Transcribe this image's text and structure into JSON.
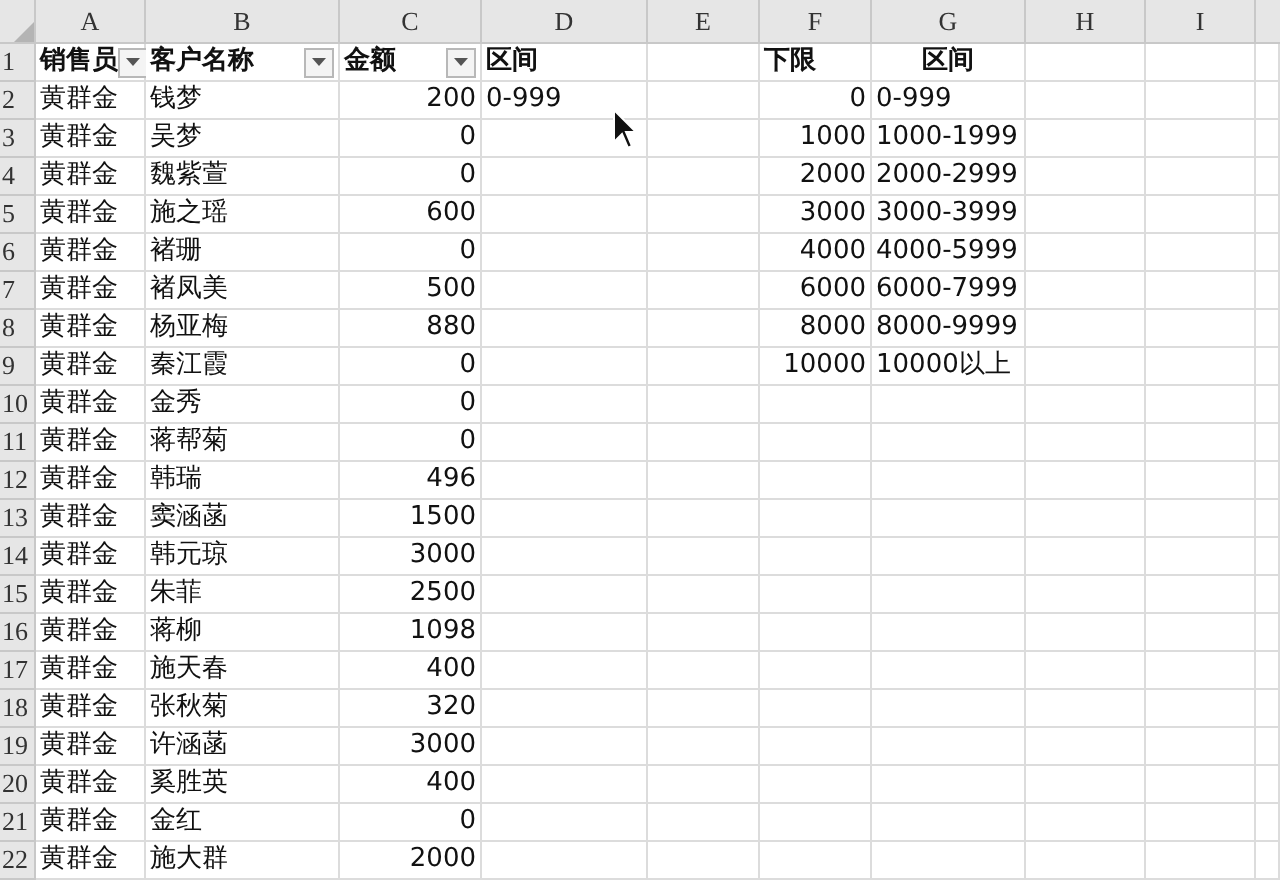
{
  "columns": [
    "A",
    "B",
    "C",
    "D",
    "E",
    "F",
    "G",
    "H",
    "I"
  ],
  "header_row": {
    "number": "1",
    "cells": {
      "a": {
        "text": "销售员",
        "centered": false,
        "filter": true
      },
      "b": {
        "text": "客户名称",
        "centered": false,
        "filter": true
      },
      "c": {
        "text": "金额",
        "centered": false,
        "filter": true
      },
      "d": {
        "text": "区间",
        "centered": false,
        "filter": false
      },
      "f": {
        "text": "下限",
        "centered": false,
        "filter": false
      },
      "g": {
        "text": "区间",
        "centered": true,
        "filter": false
      }
    }
  },
  "rows": [
    {
      "number": "2",
      "a": "黄群金",
      "b": "钱梦",
      "c": "200",
      "d": "0-999",
      "f": "0",
      "g": "0-999"
    },
    {
      "number": "3",
      "a": "黄群金",
      "b": "吴梦",
      "c": "0",
      "f": "1000",
      "g": "1000-1999"
    },
    {
      "number": "4",
      "a": "黄群金",
      "b": "魏紫萱",
      "c": "0",
      "f": "2000",
      "g": "2000-2999"
    },
    {
      "number": "5",
      "a": "黄群金",
      "b": "施之瑶",
      "c": "600",
      "f": "3000",
      "g": "3000-3999"
    },
    {
      "number": "6",
      "a": "黄群金",
      "b": "褚珊",
      "c": "0",
      "f": "4000",
      "g": "4000-5999"
    },
    {
      "number": "7",
      "a": "黄群金",
      "b": "褚凤美",
      "c": "500",
      "f": "6000",
      "g": "6000-7999"
    },
    {
      "number": "8",
      "a": "黄群金",
      "b": "杨亚梅",
      "c": "880",
      "f": "8000",
      "g": "8000-9999"
    },
    {
      "number": "9",
      "a": "黄群金",
      "b": "秦江霞",
      "c": "0",
      "f": "10000",
      "g": "10000以上"
    },
    {
      "number": "10",
      "a": "黄群金",
      "b": "金秀",
      "c": "0"
    },
    {
      "number": "11",
      "a": "黄群金",
      "b": "蒋帮菊",
      "c": "0"
    },
    {
      "number": "12",
      "a": "黄群金",
      "b": "韩瑞",
      "c": "496"
    },
    {
      "number": "13",
      "a": "黄群金",
      "b": "窦涵菡",
      "c": "1500"
    },
    {
      "number": "14",
      "a": "黄群金",
      "b": "韩元琼",
      "c": "3000"
    },
    {
      "number": "15",
      "a": "黄群金",
      "b": "朱菲",
      "c": "2500"
    },
    {
      "number": "16",
      "a": "黄群金",
      "b": "蒋柳",
      "c": "1098"
    },
    {
      "number": "17",
      "a": "黄群金",
      "b": "施天春",
      "c": "400"
    },
    {
      "number": "18",
      "a": "黄群金",
      "b": "张秋菊",
      "c": "320"
    },
    {
      "number": "19",
      "a": "黄群金",
      "b": "许涵菡",
      "c": "3000"
    },
    {
      "number": "20",
      "a": "黄群金",
      "b": "奚胜英",
      "c": "400"
    },
    {
      "number": "21",
      "a": "黄群金",
      "b": "金红",
      "c": "0"
    },
    {
      "number": "22",
      "a": "黄群金",
      "b": "施大群",
      "c": "2000"
    }
  ]
}
